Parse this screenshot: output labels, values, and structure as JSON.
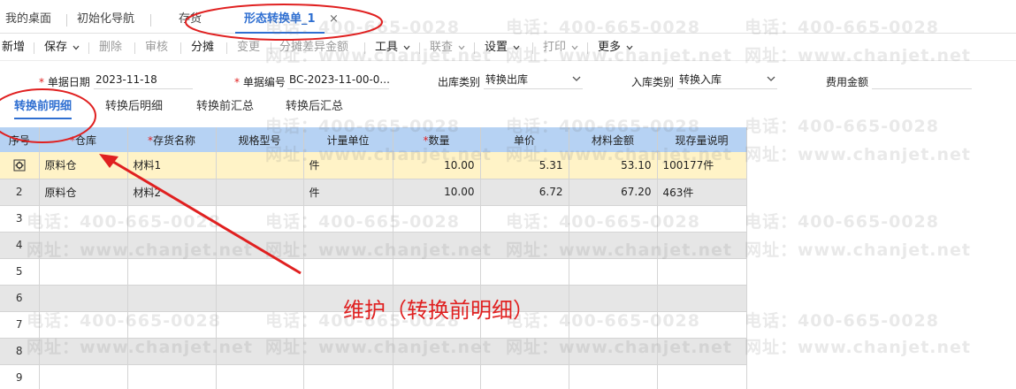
{
  "tabs": [
    {
      "label": "我的桌面"
    },
    {
      "label": "初始化导航"
    },
    {
      "label": "存货"
    },
    {
      "label": "形态转换单_1"
    }
  ],
  "tab_close_glyph": "×",
  "toolbar": {
    "new": "新增",
    "save": "保存",
    "delete": "删除",
    "audit": "审核",
    "allocate": "分摊",
    "change": "变更",
    "allocate_diff": "分摊差异金额",
    "tools": "工具",
    "linked_query": "联查",
    "settings": "设置",
    "print": "打印",
    "more": "更多"
  },
  "form": {
    "date_label": "单据日期",
    "date_value": "2023-11-18",
    "number_label": "单据编号",
    "number_value": "BC-2023-11-00-0...",
    "out_type_label": "出库类别",
    "out_type_value": "转换出库",
    "in_type_label": "入库类别",
    "in_type_value": "转换入库",
    "fee_label": "费用金额",
    "fee_value": ""
  },
  "subtabs": [
    {
      "label": "转换前明细"
    },
    {
      "label": "转换后明细"
    },
    {
      "label": "转换前汇总"
    },
    {
      "label": "转换后汇总"
    }
  ],
  "grid": {
    "columns": [
      "序号",
      "仓库",
      "存货名称",
      "规格型号",
      "计量单位",
      "数量",
      "单价",
      "材料金额",
      "现存量说明"
    ],
    "rows": [
      {
        "seq": "",
        "warehouse": "原料仓",
        "item": "材料1",
        "spec": "",
        "unit": "件",
        "qty": "10.00",
        "price": "5.31",
        "amount": "53.10",
        "stock": "100177件"
      },
      {
        "seq": "2",
        "warehouse": "原料仓",
        "item": "材料2",
        "spec": "",
        "unit": "件",
        "qty": "10.00",
        "price": "6.72",
        "amount": "67.20",
        "stock": "463件"
      },
      {
        "seq": "3",
        "warehouse": "",
        "item": "",
        "spec": "",
        "unit": "",
        "qty": "",
        "price": "",
        "amount": "",
        "stock": ""
      },
      {
        "seq": "4",
        "warehouse": "",
        "item": "",
        "spec": "",
        "unit": "",
        "qty": "",
        "price": "",
        "amount": "",
        "stock": ""
      },
      {
        "seq": "5",
        "warehouse": "",
        "item": "",
        "spec": "",
        "unit": "",
        "qty": "",
        "price": "",
        "amount": "",
        "stock": ""
      },
      {
        "seq": "6",
        "warehouse": "",
        "item": "",
        "spec": "",
        "unit": "",
        "qty": "",
        "price": "",
        "amount": "",
        "stock": ""
      },
      {
        "seq": "7",
        "warehouse": "",
        "item": "",
        "spec": "",
        "unit": "",
        "qty": "",
        "price": "",
        "amount": "",
        "stock": ""
      },
      {
        "seq": "8",
        "warehouse": "",
        "item": "",
        "spec": "",
        "unit": "",
        "qty": "",
        "price": "",
        "amount": "",
        "stock": ""
      },
      {
        "seq": "9",
        "warehouse": "",
        "item": "",
        "spec": "",
        "unit": "",
        "qty": "",
        "price": "",
        "amount": "",
        "stock": ""
      }
    ]
  },
  "row1_icon": "gear-icon",
  "watermark": {
    "phone": "电话：400-665-0028",
    "site": "网址：www.chanjet.net"
  },
  "annotation": {
    "text": "维护（转换前明细）",
    "color": "#e02020"
  },
  "colors": {
    "accent": "#2f6fd1",
    "header_bg": "#b6d2f3",
    "highlight_row": "#fff3c7",
    "alt_row": "#e6e6e6",
    "required": "#e02020"
  }
}
